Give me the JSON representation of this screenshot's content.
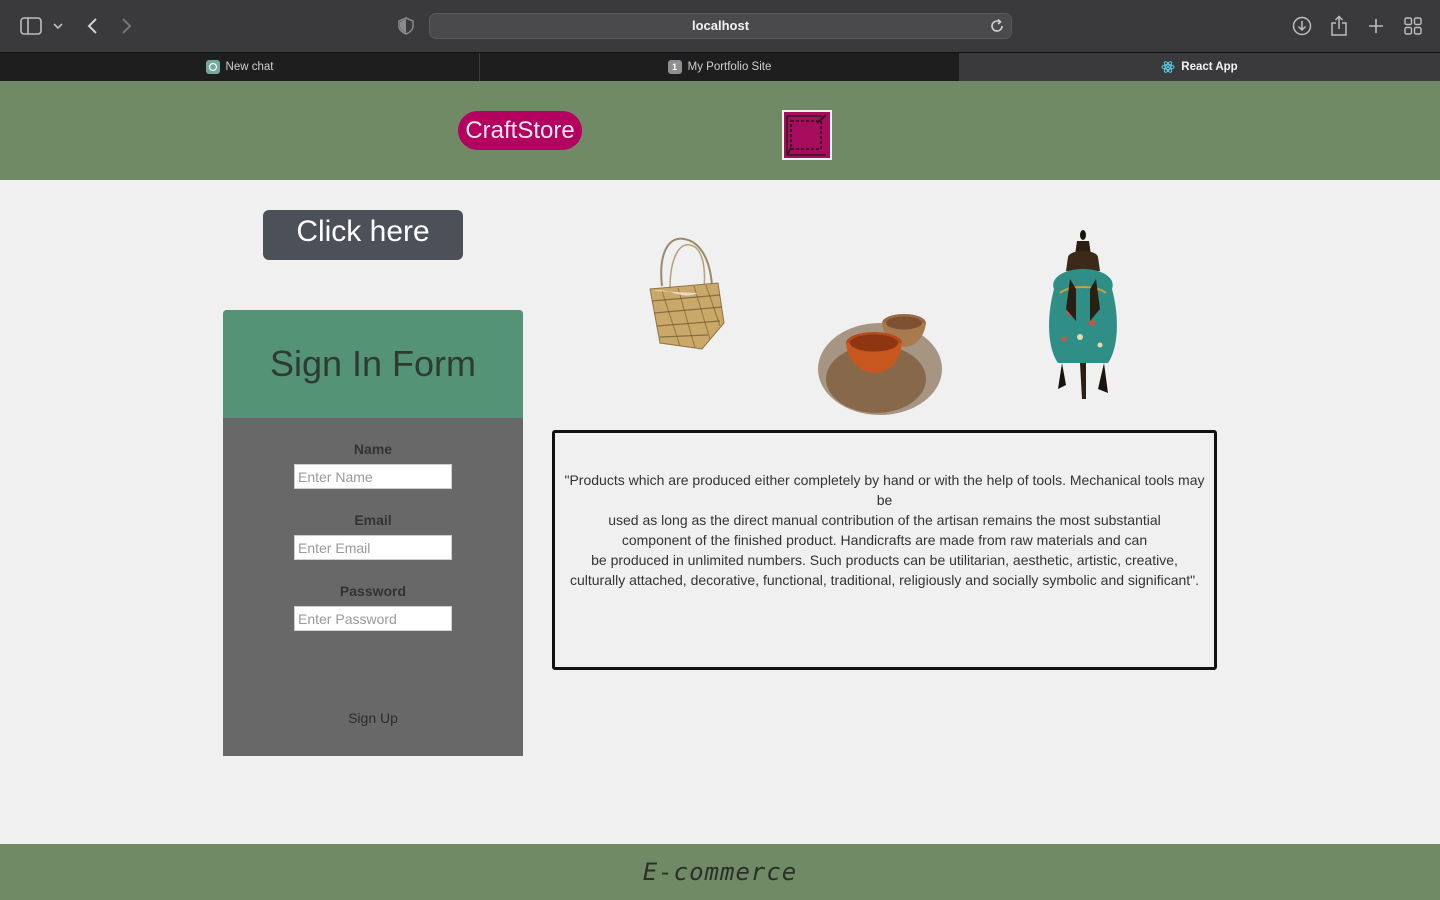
{
  "browser": {
    "url": "localhost",
    "tabs": [
      {
        "label": "New chat",
        "favicon_color": "#74aa9c",
        "active": false
      },
      {
        "label": "My Portfolio Site",
        "favicon_text": "1",
        "favicon_color": "#8e8e93",
        "active": false
      },
      {
        "label": "React App",
        "favicon_color": "#61dafb",
        "active": true
      }
    ]
  },
  "header": {
    "logo_label": "CraftStore",
    "logo_color": "#b4005f",
    "header_bg": "#708a66"
  },
  "main": {
    "cta_label": "Click here"
  },
  "signin": {
    "title": "Sign In Form",
    "fields": [
      {
        "label": "Name",
        "placeholder": "Enter Name"
      },
      {
        "label": "Email",
        "placeholder": "Enter Email"
      },
      {
        "label": "Password",
        "placeholder": "Enter Password"
      }
    ],
    "signup_label": "Sign Up"
  },
  "products": [
    {
      "name": "woven-basket"
    },
    {
      "name": "clay-bowls"
    },
    {
      "name": "enamel-vase"
    }
  ],
  "description": {
    "text": "\"Products which are produced either completely by hand or with the help of tools. Mechanical tools may be\nused as long as the direct manual contribution of the artisan remains the most substantial\ncomponent of the finished product. Handicrafts are made from raw materials and can\nbe produced in unlimited numbers. Such products can be utilitarian, aesthetic, artistic, creative,\nculturally attached, decorative, functional, traditional, religiously and socially symbolic and significant\"."
  },
  "footer": {
    "label": "E-commerce"
  }
}
